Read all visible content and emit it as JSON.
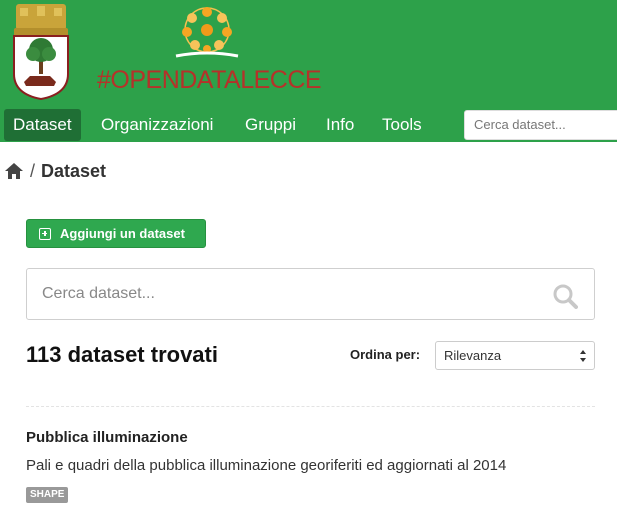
{
  "header": {
    "brand_text": "#OPENDATALECCE",
    "crest_icon": "city-crest-icon",
    "logo_icon": "opendata-balls-logo-icon",
    "colors": {
      "header_bg": "#2da14a",
      "nav_active_bg": "#1f6f35",
      "brand_text": "#b5322a"
    }
  },
  "nav": {
    "items": [
      {
        "label": "Dataset",
        "active": true
      },
      {
        "label": "Organizzazioni",
        "active": false
      },
      {
        "label": "Gruppi",
        "active": false
      },
      {
        "label": "Info",
        "active": false
      },
      {
        "label": "Tools",
        "active": false
      }
    ],
    "search_placeholder": "Cerca dataset..."
  },
  "breadcrumb": {
    "home_icon": "home-icon",
    "separator": "/",
    "current": "Dataset"
  },
  "actions": {
    "add_label": "Aggiungi un dataset",
    "add_icon": "plus-square-icon"
  },
  "search": {
    "placeholder": "Cerca dataset...",
    "icon": "search-icon"
  },
  "results": {
    "count_text": "113 dataset trovati",
    "sort_label": "Ordina per:",
    "sort_selected": "Rilevanza"
  },
  "datasets": [
    {
      "title": "Pubblica illuminazione",
      "description": "Pali e quadri della pubblica illuminazione georiferiti ed aggiornati al 2014",
      "formats": [
        "SHAPE"
      ]
    }
  ]
}
